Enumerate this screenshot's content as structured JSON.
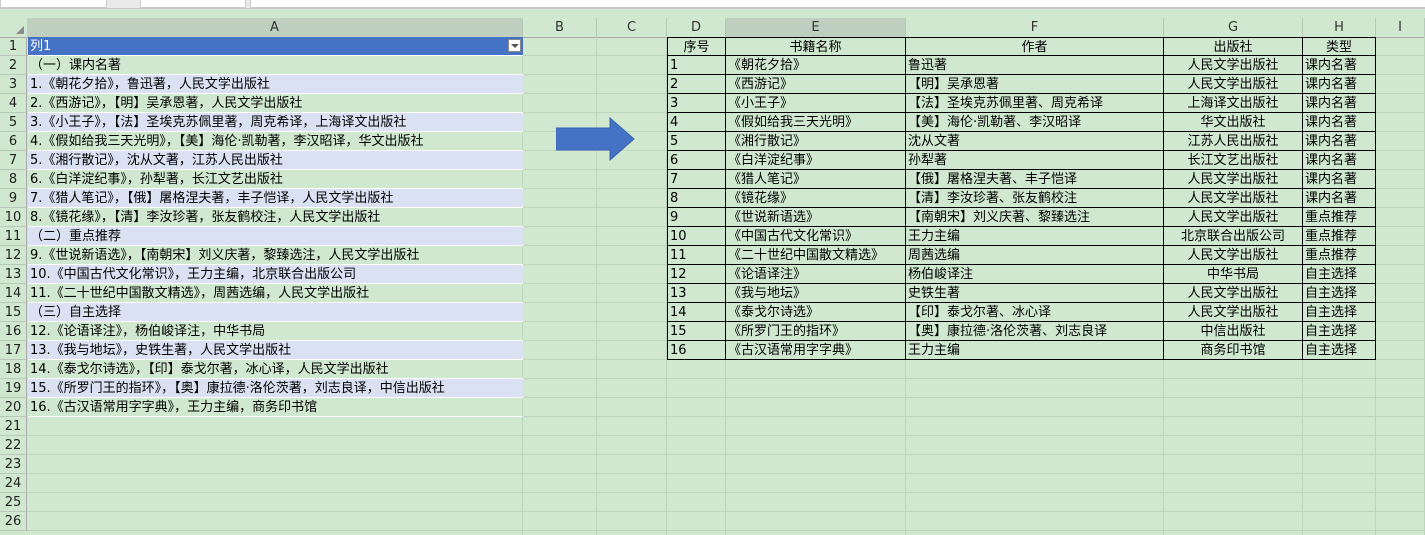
{
  "columns": [
    "A",
    "B",
    "C",
    "D",
    "E",
    "F",
    "G",
    "H",
    "I"
  ],
  "left_list": {
    "header": "列1",
    "items": [
      "（一）课内名著",
      "1.《朝花夕拾》，鲁迅著，人民文学出版社",
      "2.《西游记》，【明】吴承恩著，人民文学出版社",
      "3.《小王子》，【法】圣埃克苏佩里著，周克希译，上海译文出版社",
      "4.《假如给我三天光明》，【美】海伦·凯勒著，李汉昭译，华文出版社",
      "5.《湘行散记》，沈从文著，江苏人民出版社",
      "6.《白洋淀纪事》，孙犁著，长江文艺出版社",
      "7.《猎人笔记》，【俄】屠格涅夫著，丰子恺译，人民文学出版社",
      "8.《镜花缘》，【清】李汝珍著，张友鹤校注，人民文学出版社",
      "（二）重点推荐",
      "9.《世说新语选》，【南朝宋】刘义庆著，黎臻选注，人民文学出版社",
      "10.《中国古代文化常识》，王力主编，北京联合出版公司",
      "11.《二十世纪中国散文精选》，周茜选编，人民文学出版社",
      "（三）自主选择",
      "12.《论语译注》，杨伯峻译注，中华书局",
      "13.《我与地坛》，史铁生著，人民文学出版社",
      "14.《泰戈尔诗选》，【印】泰戈尔著，冰心译，人民文学出版社",
      "15.《所罗门王的指环》，【奥】康拉德·洛伦茨著，刘志良译，中信出版社",
      "16.《古汉语常用字字典》，王力主编，商务印书馆"
    ]
  },
  "right_table": {
    "headers": [
      "序号",
      "书籍名称",
      "作者",
      "出版社",
      "类型"
    ],
    "rows": [
      [
        "1",
        "《朝花夕拾》",
        "鲁迅著",
        "人民文学出版社",
        "课内名著"
      ],
      [
        "2",
        "《西游记》",
        "【明】吴承恩著",
        "人民文学出版社",
        "课内名著"
      ],
      [
        "3",
        "《小王子》",
        "【法】圣埃克苏佩里著、周克希译",
        "上海译文出版社",
        "课内名著"
      ],
      [
        "4",
        "《假如给我三天光明》",
        "【美】海伦·凯勒著、李汉昭译",
        "华文出版社",
        "课内名著"
      ],
      [
        "5",
        "《湘行散记》",
        "沈从文著",
        "江苏人民出版社",
        "课内名著"
      ],
      [
        "6",
        "《白洋淀纪事》",
        "孙犁著",
        "长江文艺出版社",
        "课内名著"
      ],
      [
        "7",
        "《猎人笔记》",
        "【俄】屠格涅夫著、丰子恺译",
        "人民文学出版社",
        "课内名著"
      ],
      [
        "8",
        "《镜花缘》",
        "【清】李汝珍著、张友鹤校注",
        "人民文学出版社",
        "课内名著"
      ],
      [
        "9",
        "《世说新语选》",
        "【南朝宋】刘义庆著、黎臻选注",
        "人民文学出版社",
        "重点推荐"
      ],
      [
        "10",
        "《中国古代文化常识》",
        "王力主编",
        "北京联合出版公司",
        "重点推荐"
      ],
      [
        "11",
        "《二十世纪中国散文精选》",
        "周茜选编",
        "人民文学出版社",
        "重点推荐"
      ],
      [
        "12",
        "《论语译注》",
        "杨伯峻译注",
        "中华书局",
        "自主选择"
      ],
      [
        "13",
        "《我与地坛》",
        "史铁生著",
        "人民文学出版社",
        "自主选择"
      ],
      [
        "14",
        "《泰戈尔诗选》",
        "【印】泰戈尔著、冰心译",
        "人民文学出版社",
        "自主选择"
      ],
      [
        "15",
        "《所罗门王的指环》",
        "【奥】康拉德·洛伦茨著、刘志良译",
        "中信出版社",
        "自主选择"
      ],
      [
        "16",
        "《古汉语常用字字典》",
        "王力主编",
        "商务印书馆",
        "自主选择"
      ]
    ]
  },
  "colors": {
    "header_blue": "#4472c4",
    "band_blue": "#d9e1f2",
    "sheet_green": "#cfe8cf",
    "arrow": "#4472c4"
  }
}
